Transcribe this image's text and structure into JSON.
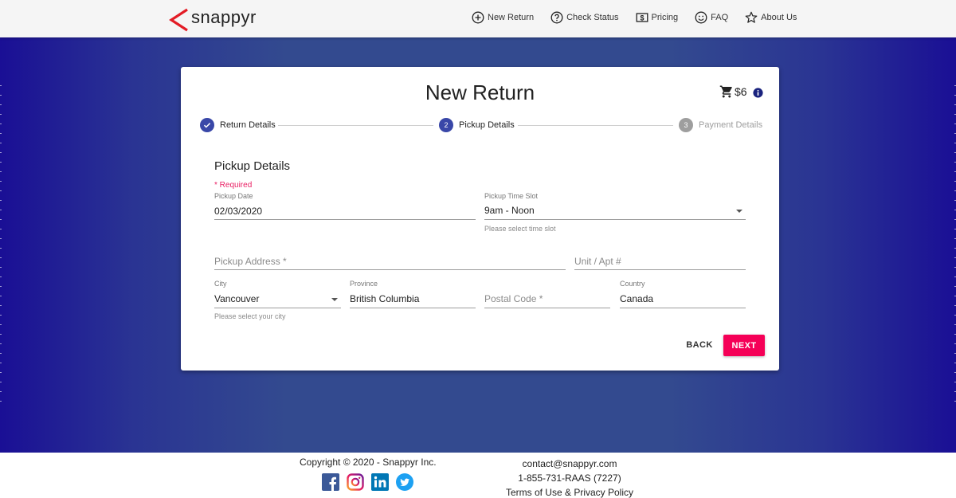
{
  "brand": {
    "name": "snappyr",
    "accent": "#e31c25"
  },
  "nav": [
    {
      "label": "New Return",
      "icon": "plus-circle-icon"
    },
    {
      "label": "Check Status",
      "icon": "question-circle-icon"
    },
    {
      "label": "Pricing",
      "icon": "dollar-bill-icon"
    },
    {
      "label": "FAQ",
      "icon": "smiley-icon"
    },
    {
      "label": "About Us",
      "icon": "star-icon"
    }
  ],
  "card": {
    "title": "New Return",
    "price": "$6",
    "steps": [
      {
        "number": "1",
        "label": "Return Details",
        "state": "completed"
      },
      {
        "number": "2",
        "label": "Pickup Details",
        "state": "active"
      },
      {
        "number": "3",
        "label": "Payment Details",
        "state": "inactive"
      }
    ],
    "section_title": "Pickup Details",
    "required_note": "* Required"
  },
  "form": {
    "pickup_date": {
      "label": "Pickup Date",
      "value": "02/03/2020"
    },
    "time_slot": {
      "label": "Pickup Time Slot",
      "value": "9am - Noon",
      "helper": "Please select time slot"
    },
    "address": {
      "placeholder": "Pickup Address *"
    },
    "unit": {
      "placeholder": "Unit / Apt #"
    },
    "city": {
      "label": "City",
      "value": "Vancouver",
      "helper": "Please select your city"
    },
    "province": {
      "label": "Province",
      "value": "British Columbia"
    },
    "postal_code": {
      "placeholder": "Postal Code *"
    },
    "country": {
      "label": "Country",
      "value": "Canada"
    }
  },
  "buttons": {
    "back": "BACK",
    "next": "NEXT"
  },
  "colors": {
    "primary": "#3947a8",
    "secondary": "#f50057",
    "background": "#334a8f"
  },
  "footer": {
    "copyright": "Copyright © 2020 - Snappyr Inc.",
    "email": "contact@snappyr.com",
    "phone": "1-855-731-RAAS (7227)",
    "terms": "Terms of Use & Privacy Policy",
    "social": [
      "facebook-icon",
      "instagram-icon",
      "linkedin-icon",
      "twitter-icon"
    ]
  }
}
